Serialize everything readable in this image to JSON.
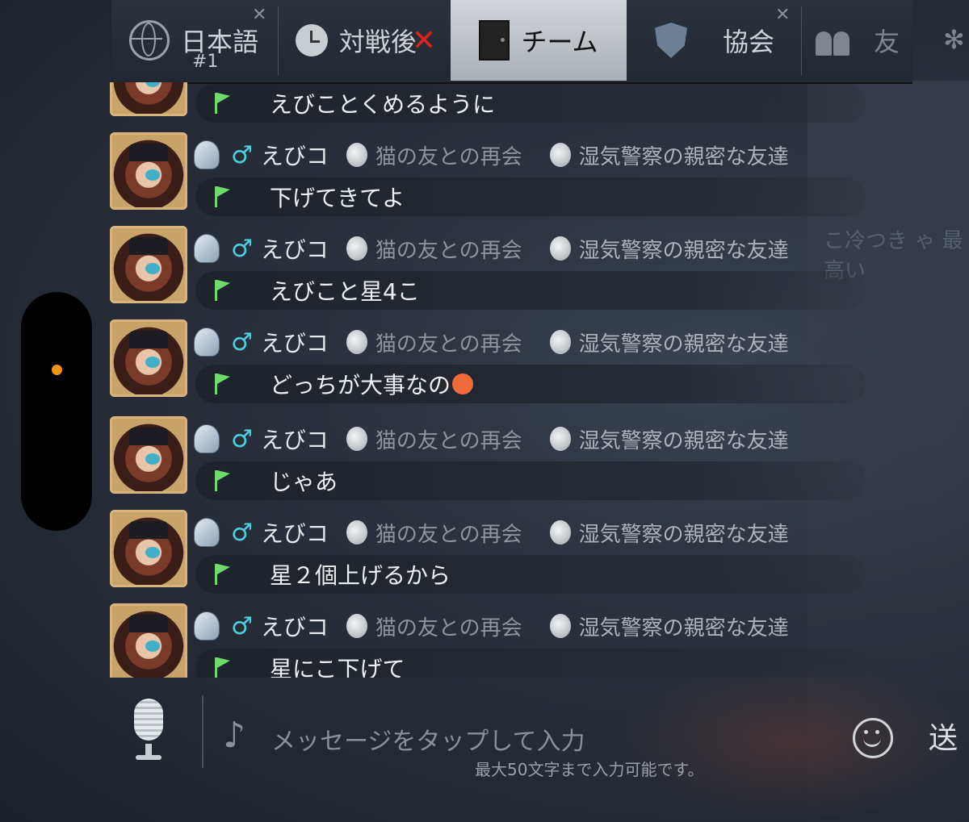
{
  "tabs": [
    {
      "label": "日本語",
      "sub": "#1",
      "icon": "globe-icon"
    },
    {
      "label": "対戦後",
      "icon": "clock-icon",
      "extra": "✕"
    },
    {
      "label": "チーム",
      "icon": "door-icon",
      "active": true
    },
    {
      "label": "協会",
      "icon": "shield-icon"
    },
    {
      "label": "友",
      "icon": "friends-icon"
    }
  ],
  "partial_message": {
    "text": "えびことくめるように"
  },
  "messages": [
    {
      "sex": "♂",
      "name": "えびコ",
      "badge1": "猫の友との再会",
      "badge2": "湿気警察の親密な友達",
      "text": "下げてきてよ"
    },
    {
      "sex": "♂",
      "name": "えびコ",
      "badge1": "猫の友との再会",
      "badge2": "湿気警察の親密な友達",
      "text": "えびこと星4こ"
    },
    {
      "sex": "♂",
      "name": "えびコ",
      "badge1": "猫の友との再会",
      "badge2": "湿気警察の親密な友達",
      "text": "どっちが大事なの",
      "emoji": "angry-face"
    },
    {
      "sex": "♂",
      "name": "えびコ",
      "badge1": "猫の友との再会",
      "badge2": "湿気警察の親密な友達",
      "text": "じゃあ"
    },
    {
      "sex": "♂",
      "name": "えびコ",
      "badge1": "猫の友との再会",
      "badge2": "湿気警察の親密な友達",
      "text": "星２個上げるから"
    },
    {
      "sex": "♂",
      "name": "えびコ",
      "badge1": "猫の友との再会",
      "badge2": "湿気警察の親密な友達",
      "text": "星にこ下げて"
    }
  ],
  "input": {
    "placeholder": "メッセージをタップして入力",
    "hint": "最大50文字まで入力可能です。",
    "send_label": "送"
  },
  "background_text": "こ冷つき ゃ 最高い",
  "colors": {
    "accent_green": "#6fd96a",
    "male_blue": "#4ad0e0",
    "dot_orange": "#f39417"
  }
}
